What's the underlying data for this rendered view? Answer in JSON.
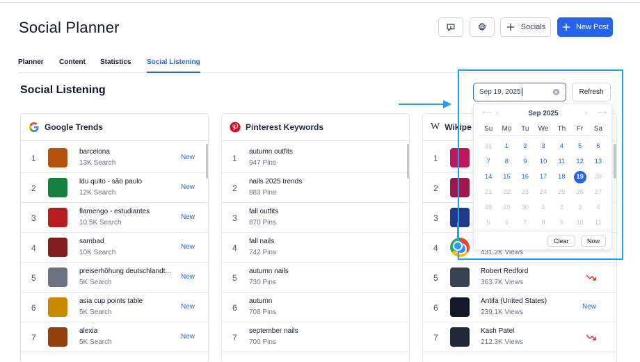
{
  "header": {
    "title": "Social Planner",
    "socials_label": "Socials",
    "new_post_label": "New Post"
  },
  "tabs": [
    {
      "label": "Planner",
      "active": false
    },
    {
      "label": "Content",
      "active": false
    },
    {
      "label": "Statistics",
      "active": false
    },
    {
      "label": "Social Listening",
      "active": true
    }
  ],
  "section": {
    "title": "Social Listening",
    "date_value": "Sep 19, 2025",
    "refresh_label": "Refresh"
  },
  "google": {
    "title": "Google Trends",
    "items": [
      {
        "rank": "1",
        "title": "barcelona",
        "sub": "13K Search",
        "badge": "New"
      },
      {
        "rank": "2",
        "title": "ldu quito - são paulo",
        "sub": "12K Search",
        "badge": "New"
      },
      {
        "rank": "3",
        "title": "flamengo - estudiantes",
        "sub": "10.5K Search",
        "badge": "New"
      },
      {
        "rank": "4",
        "title": "sambad",
        "sub": "10K Search",
        "badge": "New"
      },
      {
        "rank": "5",
        "title": "preiserhöhung deutschlandt...",
        "sub": "5K Search",
        "badge": "New"
      },
      {
        "rank": "6",
        "title": "asia cup points table",
        "sub": "5K Search",
        "badge": "New"
      },
      {
        "rank": "7",
        "title": "alexia",
        "sub": "5K Search",
        "badge": "New"
      }
    ]
  },
  "pinterest": {
    "title": "Pinterest Keywords",
    "items": [
      {
        "rank": "1",
        "title": "autumn outfits",
        "sub": "947 Pins"
      },
      {
        "rank": "2",
        "title": "nails 2025 trends",
        "sub": "883 Pins"
      },
      {
        "rank": "3",
        "title": "fall outfits",
        "sub": "870 Pins"
      },
      {
        "rank": "4",
        "title": "fall nails",
        "sub": "742 Pins"
      },
      {
        "rank": "5",
        "title": "autumn nails",
        "sub": "730 Pins"
      },
      {
        "rank": "6",
        "title": "autumn",
        "sub": "708 Pins"
      },
      {
        "rank": "7",
        "title": "september nails",
        "sub": "700 Pins"
      }
    ]
  },
  "wiki": {
    "title": "Wikipe",
    "items": [
      {
        "rank": "1",
        "title": "",
        "sub": "",
        "trend": "",
        "badge": ""
      },
      {
        "rank": "2",
        "title": "",
        "sub": "",
        "trend": "",
        "badge": ""
      },
      {
        "rank": "3",
        "title": "",
        "sub": "",
        "trend": "",
        "badge": ""
      },
      {
        "rank": "4",
        "title": "",
        "sub": "431.2K Views",
        "trend": "",
        "badge": ""
      },
      {
        "rank": "5",
        "title": "Robert Redford",
        "sub": "363.7K Views",
        "trend": "down",
        "badge": ""
      },
      {
        "rank": "6",
        "title": "Antifa (United States)",
        "sub": "239.1K Views",
        "trend": "",
        "badge": "New"
      },
      {
        "rank": "7",
        "title": "Kash Patel",
        "sub": "212.3K Views",
        "trend": "down",
        "badge": ""
      }
    ]
  },
  "calendar": {
    "month_label": "Sep 2025",
    "weekdays": [
      "Su",
      "Mo",
      "Tu",
      "We",
      "Th",
      "Fr",
      "Sa"
    ],
    "days": [
      {
        "d": "31",
        "m": true
      },
      {
        "d": "1"
      },
      {
        "d": "2"
      },
      {
        "d": "3"
      },
      {
        "d": "4"
      },
      {
        "d": "5"
      },
      {
        "d": "6"
      },
      {
        "d": "7"
      },
      {
        "d": "8"
      },
      {
        "d": "9"
      },
      {
        "d": "10"
      },
      {
        "d": "11"
      },
      {
        "d": "12"
      },
      {
        "d": "13"
      },
      {
        "d": "14"
      },
      {
        "d": "15"
      },
      {
        "d": "16"
      },
      {
        "d": "17"
      },
      {
        "d": "18"
      },
      {
        "d": "19",
        "sel": true
      },
      {
        "d": "20",
        "m": true
      },
      {
        "d": "21",
        "m": true
      },
      {
        "d": "22",
        "m": true
      },
      {
        "d": "23",
        "m": true
      },
      {
        "d": "24",
        "m": true
      },
      {
        "d": "25",
        "m": true
      },
      {
        "d": "26",
        "m": true
      },
      {
        "d": "27",
        "m": true
      },
      {
        "d": "28",
        "m": true
      },
      {
        "d": "29",
        "m": true
      },
      {
        "d": "30",
        "m": true
      },
      {
        "d": "1",
        "m": true
      },
      {
        "d": "2",
        "m": true
      },
      {
        "d": "3",
        "m": true
      },
      {
        "d": "4",
        "m": true
      },
      {
        "d": "5",
        "m": true
      },
      {
        "d": "6",
        "m": true
      },
      {
        "d": "7",
        "m": true
      },
      {
        "d": "8",
        "m": true
      },
      {
        "d": "9",
        "m": true
      },
      {
        "d": "10",
        "m": true
      },
      {
        "d": "11",
        "m": true
      }
    ],
    "clear_label": "Clear",
    "now_label": "Now"
  },
  "colors": {
    "accent": "#2563eb",
    "annotation": "#1ea1ef",
    "trend_down": "#dc2626"
  },
  "icons": {
    "feedback": "message-alert-icon",
    "settings": "gear-icon",
    "socials": "plus-icon",
    "new_post": "plus-icon",
    "google": "google-logo-icon",
    "pinterest": "pinterest-logo-icon",
    "wiki": "wikipedia-logo-icon",
    "trend_down": "trend-down-icon"
  }
}
